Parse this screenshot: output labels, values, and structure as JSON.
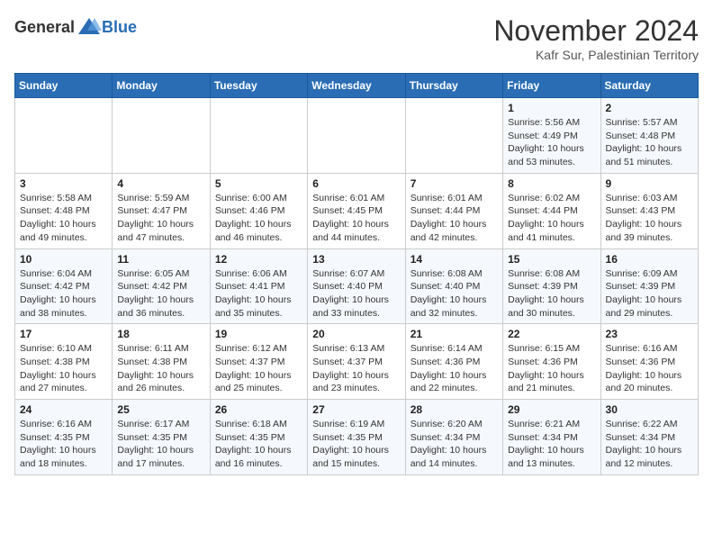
{
  "header": {
    "logo_general": "General",
    "logo_blue": "Blue",
    "month_year": "November 2024",
    "location": "Kafr Sur, Palestinian Territory"
  },
  "weekdays": [
    "Sunday",
    "Monday",
    "Tuesday",
    "Wednesday",
    "Thursday",
    "Friday",
    "Saturday"
  ],
  "weeks": [
    [
      {
        "day": "",
        "info": ""
      },
      {
        "day": "",
        "info": ""
      },
      {
        "day": "",
        "info": ""
      },
      {
        "day": "",
        "info": ""
      },
      {
        "day": "",
        "info": ""
      },
      {
        "day": "1",
        "info": "Sunrise: 5:56 AM\nSunset: 4:49 PM\nDaylight: 10 hours and 53 minutes."
      },
      {
        "day": "2",
        "info": "Sunrise: 5:57 AM\nSunset: 4:48 PM\nDaylight: 10 hours and 51 minutes."
      }
    ],
    [
      {
        "day": "3",
        "info": "Sunrise: 5:58 AM\nSunset: 4:48 PM\nDaylight: 10 hours and 49 minutes."
      },
      {
        "day": "4",
        "info": "Sunrise: 5:59 AM\nSunset: 4:47 PM\nDaylight: 10 hours and 47 minutes."
      },
      {
        "day": "5",
        "info": "Sunrise: 6:00 AM\nSunset: 4:46 PM\nDaylight: 10 hours and 46 minutes."
      },
      {
        "day": "6",
        "info": "Sunrise: 6:01 AM\nSunset: 4:45 PM\nDaylight: 10 hours and 44 minutes."
      },
      {
        "day": "7",
        "info": "Sunrise: 6:01 AM\nSunset: 4:44 PM\nDaylight: 10 hours and 42 minutes."
      },
      {
        "day": "8",
        "info": "Sunrise: 6:02 AM\nSunset: 4:44 PM\nDaylight: 10 hours and 41 minutes."
      },
      {
        "day": "9",
        "info": "Sunrise: 6:03 AM\nSunset: 4:43 PM\nDaylight: 10 hours and 39 minutes."
      }
    ],
    [
      {
        "day": "10",
        "info": "Sunrise: 6:04 AM\nSunset: 4:42 PM\nDaylight: 10 hours and 38 minutes."
      },
      {
        "day": "11",
        "info": "Sunrise: 6:05 AM\nSunset: 4:42 PM\nDaylight: 10 hours and 36 minutes."
      },
      {
        "day": "12",
        "info": "Sunrise: 6:06 AM\nSunset: 4:41 PM\nDaylight: 10 hours and 35 minutes."
      },
      {
        "day": "13",
        "info": "Sunrise: 6:07 AM\nSunset: 4:40 PM\nDaylight: 10 hours and 33 minutes."
      },
      {
        "day": "14",
        "info": "Sunrise: 6:08 AM\nSunset: 4:40 PM\nDaylight: 10 hours and 32 minutes."
      },
      {
        "day": "15",
        "info": "Sunrise: 6:08 AM\nSunset: 4:39 PM\nDaylight: 10 hours and 30 minutes."
      },
      {
        "day": "16",
        "info": "Sunrise: 6:09 AM\nSunset: 4:39 PM\nDaylight: 10 hours and 29 minutes."
      }
    ],
    [
      {
        "day": "17",
        "info": "Sunrise: 6:10 AM\nSunset: 4:38 PM\nDaylight: 10 hours and 27 minutes."
      },
      {
        "day": "18",
        "info": "Sunrise: 6:11 AM\nSunset: 4:38 PM\nDaylight: 10 hours and 26 minutes."
      },
      {
        "day": "19",
        "info": "Sunrise: 6:12 AM\nSunset: 4:37 PM\nDaylight: 10 hours and 25 minutes."
      },
      {
        "day": "20",
        "info": "Sunrise: 6:13 AM\nSunset: 4:37 PM\nDaylight: 10 hours and 23 minutes."
      },
      {
        "day": "21",
        "info": "Sunrise: 6:14 AM\nSunset: 4:36 PM\nDaylight: 10 hours and 22 minutes."
      },
      {
        "day": "22",
        "info": "Sunrise: 6:15 AM\nSunset: 4:36 PM\nDaylight: 10 hours and 21 minutes."
      },
      {
        "day": "23",
        "info": "Sunrise: 6:16 AM\nSunset: 4:36 PM\nDaylight: 10 hours and 20 minutes."
      }
    ],
    [
      {
        "day": "24",
        "info": "Sunrise: 6:16 AM\nSunset: 4:35 PM\nDaylight: 10 hours and 18 minutes."
      },
      {
        "day": "25",
        "info": "Sunrise: 6:17 AM\nSunset: 4:35 PM\nDaylight: 10 hours and 17 minutes."
      },
      {
        "day": "26",
        "info": "Sunrise: 6:18 AM\nSunset: 4:35 PM\nDaylight: 10 hours and 16 minutes."
      },
      {
        "day": "27",
        "info": "Sunrise: 6:19 AM\nSunset: 4:35 PM\nDaylight: 10 hours and 15 minutes."
      },
      {
        "day": "28",
        "info": "Sunrise: 6:20 AM\nSunset: 4:34 PM\nDaylight: 10 hours and 14 minutes."
      },
      {
        "day": "29",
        "info": "Sunrise: 6:21 AM\nSunset: 4:34 PM\nDaylight: 10 hours and 13 minutes."
      },
      {
        "day": "30",
        "info": "Sunrise: 6:22 AM\nSunset: 4:34 PM\nDaylight: 10 hours and 12 minutes."
      }
    ]
  ]
}
